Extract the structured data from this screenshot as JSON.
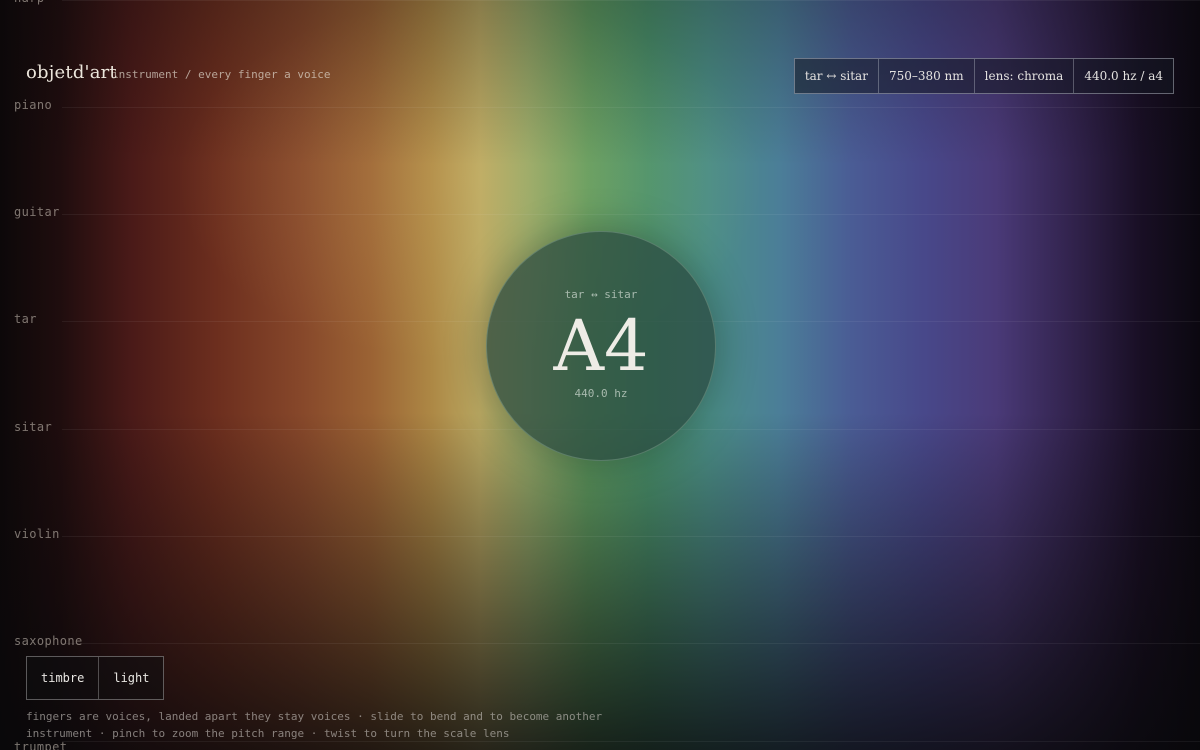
{
  "brand": {
    "name": "objetd'art",
    "tagline": "instrument / every finger a voice"
  },
  "instruments": [
    "harp",
    "piano",
    "guitar",
    "tar",
    "sitar",
    "violin",
    "saxophone",
    "trumpet"
  ],
  "status": {
    "pair": "tar ↔ sitar",
    "wavelength": "750–380 nm",
    "lens": "lens: chroma",
    "tuning": "440.0 hz / a4"
  },
  "center": {
    "pair": "tar ↔ sitar",
    "note": "A4",
    "frequency": "440.0 hz"
  },
  "modes": {
    "timbre": "timbre",
    "light": "light"
  },
  "help": {
    "line1": "fingers are voices, landed apart they stay voices · slide to bend and to become another",
    "line2": "instrument · pinch to zoom the pitch range · twist to turn the scale lens"
  }
}
